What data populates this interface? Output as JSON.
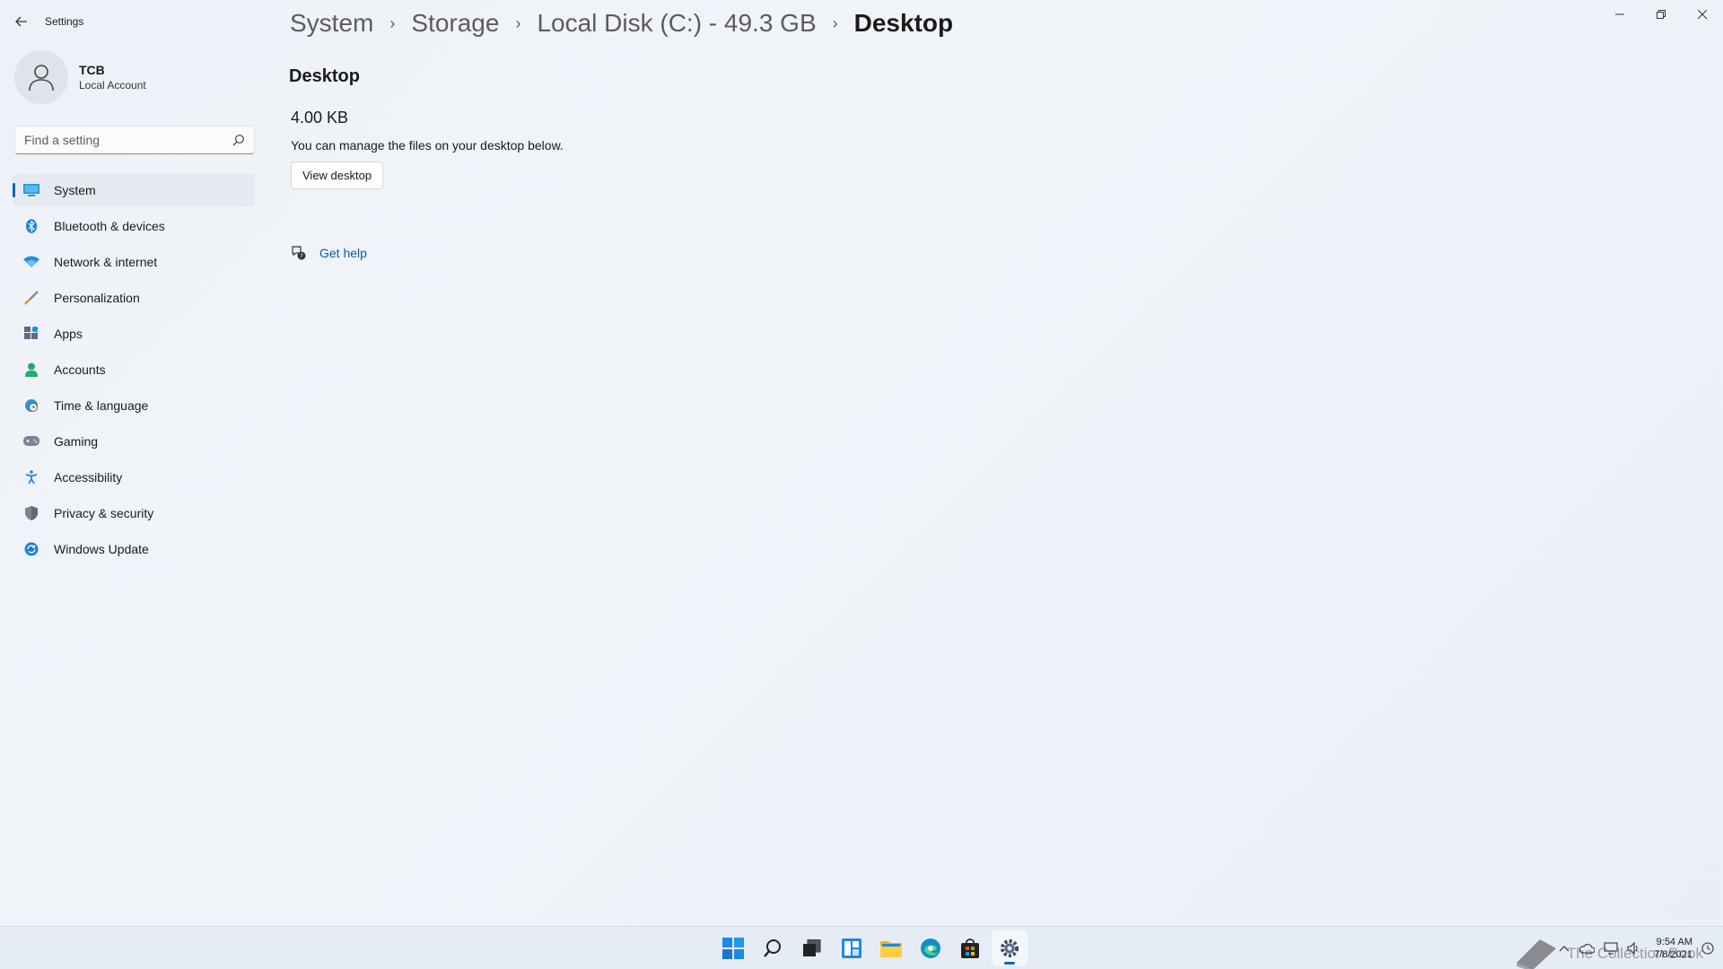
{
  "window": {
    "app_title": "Settings",
    "icons": {
      "back": "back-arrow-icon",
      "minimize": "minimize-icon",
      "restore": "restore-icon",
      "close": "close-icon"
    }
  },
  "profile": {
    "name": "TCB",
    "account_type": "Local Account"
  },
  "search": {
    "placeholder": "Find a setting",
    "value": ""
  },
  "nav": {
    "items": [
      {
        "label": "System",
        "icon": "system-icon",
        "active": true
      },
      {
        "label": "Bluetooth & devices",
        "icon": "bluetooth-icon"
      },
      {
        "label": "Network & internet",
        "icon": "wifi-icon"
      },
      {
        "label": "Personalization",
        "icon": "brush-icon"
      },
      {
        "label": "Apps",
        "icon": "apps-icon"
      },
      {
        "label": "Accounts",
        "icon": "person-icon"
      },
      {
        "label": "Time & language",
        "icon": "globe-clock-icon"
      },
      {
        "label": "Gaming",
        "icon": "gamepad-icon"
      },
      {
        "label": "Accessibility",
        "icon": "accessibility-icon"
      },
      {
        "label": "Privacy & security",
        "icon": "shield-icon"
      },
      {
        "label": "Windows Update",
        "icon": "update-icon"
      }
    ]
  },
  "breadcrumb": {
    "items": [
      "System",
      "Storage",
      "Local Disk (C:) - 49.3 GB"
    ],
    "current": "Desktop"
  },
  "main": {
    "section_title": "Desktop",
    "size": "4.00 KB",
    "description": "You can manage the files on your desktop below.",
    "view_button": "View desktop",
    "help_link": "Get help"
  },
  "taskbar": {
    "apps": [
      "start-icon",
      "search-icon",
      "task-view-icon",
      "widgets-icon",
      "file-explorer-icon",
      "edge-icon",
      "store-icon",
      "settings-icon"
    ],
    "clock_time": "9:54 AM",
    "clock_date": "7/8/2021",
    "watermark": "The Collection Book"
  },
  "colors": {
    "accent": "#0067c0",
    "link": "#0a5aa8"
  }
}
